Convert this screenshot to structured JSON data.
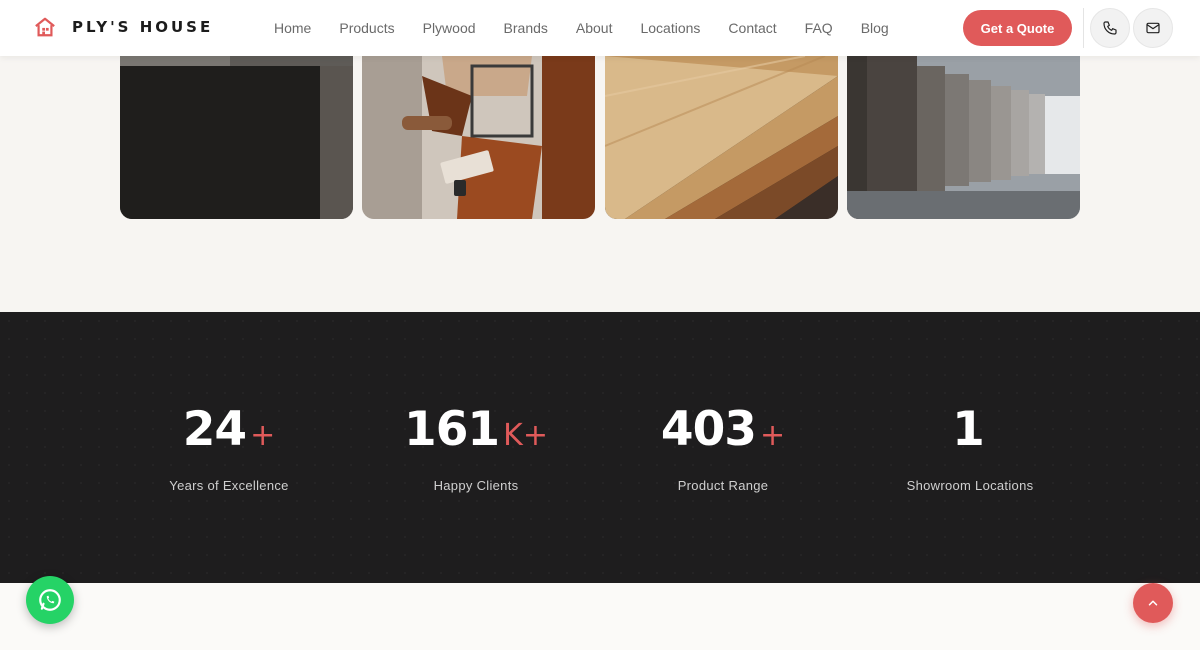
{
  "brand": {
    "name": "PLY'S HOUSE",
    "icon": "house-logo-icon",
    "accent": "#e05a5a"
  },
  "nav": {
    "items": [
      {
        "label": "Home"
      },
      {
        "label": "Products"
      },
      {
        "label": "Plywood"
      },
      {
        "label": "Brands"
      },
      {
        "label": "About"
      },
      {
        "label": "Locations"
      },
      {
        "label": "Contact"
      },
      {
        "label": "FAQ"
      },
      {
        "label": "Blog"
      }
    ],
    "cta_label": "Get a Quote",
    "phone_icon": "phone-icon",
    "mail_icon": "mail-icon"
  },
  "gallery": {
    "cards": [
      {
        "icon": "dark-stone-image"
      },
      {
        "icon": "reading-person-image"
      },
      {
        "icon": "wood-veneer-image"
      },
      {
        "icon": "wall-panels-image"
      }
    ]
  },
  "stats": {
    "items": [
      {
        "number": "24",
        "suffix": "+",
        "label": "Years of Excellence"
      },
      {
        "number": "161",
        "suffix": "K+",
        "label": "Happy Clients"
      },
      {
        "number": "403",
        "suffix": "+",
        "label": "Product Range"
      },
      {
        "number": "1",
        "suffix": "",
        "label": "Showroom Locations"
      }
    ]
  },
  "floating": {
    "whatsapp_icon": "whatsapp-icon",
    "scroll_top_icon": "chevron-up-icon"
  }
}
